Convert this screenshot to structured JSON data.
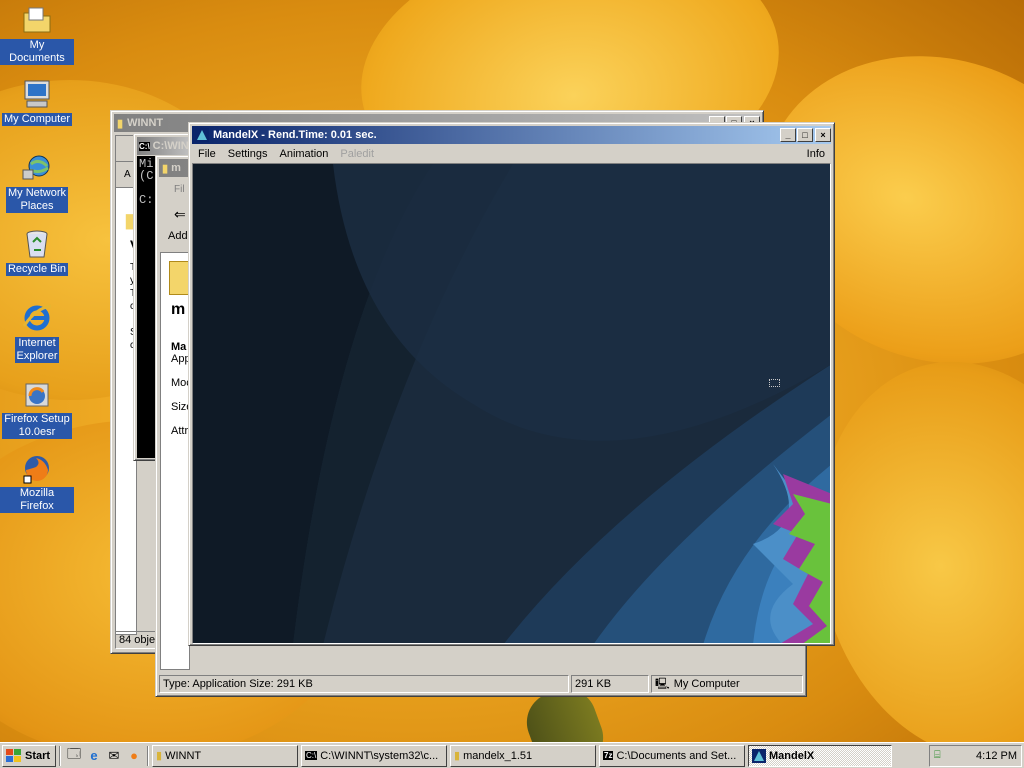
{
  "desktop": {
    "icons": [
      {
        "label": "My Documents",
        "icon": "folder-documents-icon"
      },
      {
        "label": "My Computer",
        "icon": "computer-icon"
      },
      {
        "label_line1": "My Network",
        "label_line2": "Places",
        "icon": "network-places-icon"
      },
      {
        "label": "Recycle Bin",
        "icon": "recycle-bin-icon"
      },
      {
        "label_line1": "Internet",
        "label_line2": "Explorer",
        "icon": "internet-explorer-icon"
      },
      {
        "label_line1": "Firefox Setup",
        "label_line2": "10.0esr",
        "icon": "firefox-setup-icon"
      },
      {
        "label": "Mozilla Firefox",
        "icon": "firefox-icon"
      }
    ]
  },
  "winnt_window": {
    "title": "WINNT",
    "status_left": "84 objec"
  },
  "cmd_window": {
    "title": "C:\\WIN",
    "lines": [
      "Mi",
      "(C",
      "",
      "C:"
    ]
  },
  "mandelx_folder_window": {
    "title": "m",
    "toolbar_file": "Fil",
    "address_label": "Add",
    "folder_heading": "m",
    "details": {
      "name_label": "Ma",
      "type_label": "App",
      "modified_label": "Moc",
      "size_label": "Size",
      "attributes_label": "Attr"
    },
    "status_type": "Type: Application Size: 291 KB",
    "status_size": "291 KB",
    "status_zone": "My Computer"
  },
  "winnt_side_text": [
    "T",
    "y",
    "T",
    "c",
    "S",
    "c"
  ],
  "mandelx_app": {
    "title": "MandelX - Rend.Time:  0.01 sec.",
    "menu": {
      "file": "File",
      "settings": "Settings",
      "animation": "Animation",
      "paledit": "Paledit",
      "info": "Info"
    },
    "colors": {
      "titlebar_start": "#0a246a",
      "titlebar_end": "#a6caf0",
      "fractal_dark": "#101d2a",
      "fractal_blue": "#3b78b3",
      "fractal_green": "#69c23c",
      "fractal_purple": "#9a3aa0"
    }
  },
  "taskbar": {
    "start_label": "Start",
    "quick_launch": [
      "show-desktop-icon",
      "internet-explorer-icon",
      "outlook-icon",
      "firefox-icon"
    ],
    "tasks": [
      {
        "label": "WINNT",
        "icon": "folder-icon"
      },
      {
        "label": "C:\\WINNT\\system32\\c...",
        "icon": "cmd-icon"
      },
      {
        "label": "mandelx_1.51",
        "icon": "folder-icon"
      },
      {
        "label": "C:\\Documents and Set...",
        "icon": "7zip-icon"
      },
      {
        "label": "MandelX",
        "icon": "mandelx-icon",
        "active": true
      }
    ],
    "clock": "4:12 PM"
  }
}
